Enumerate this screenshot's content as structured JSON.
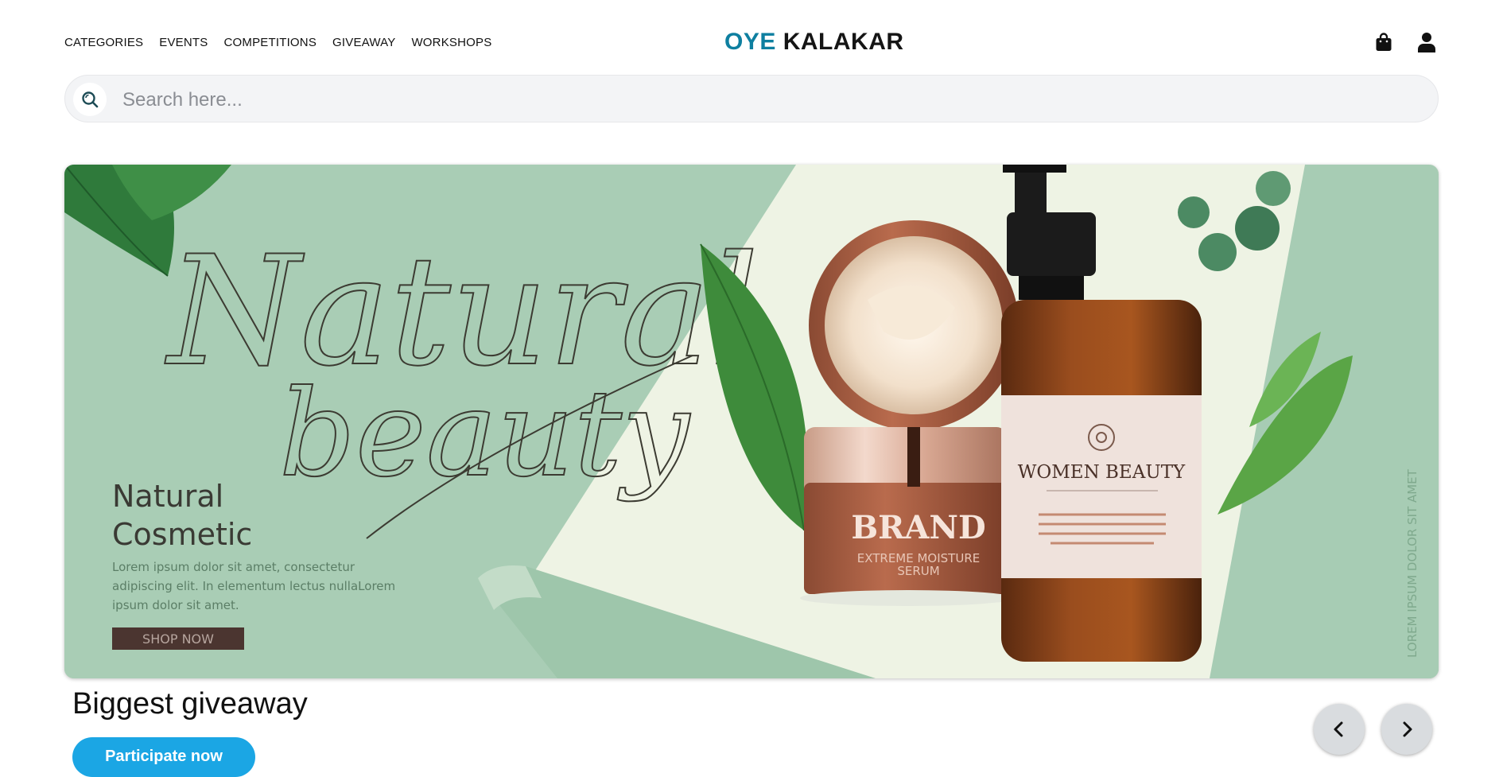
{
  "header": {
    "nav": [
      "CATEGORIES",
      "EVENTS",
      "COMPETITIONS",
      "GIVEAWAY",
      "WORKSHOPS"
    ],
    "logo_part1": "OYE",
    "logo_part2": "KALAKAR",
    "icons": [
      "shopping-bag-icon",
      "user-icon"
    ]
  },
  "search": {
    "placeholder": "Search here..."
  },
  "banner": {
    "script_line1": "Natural",
    "script_line2": "beauty",
    "heading_line1": "Natural",
    "heading_line2": "Cosmetic",
    "body_line1": "Lorem ipsum dolor sit amet, consectetur",
    "body_line2": "adipiscing elit. In elementum lectus nullaLorem",
    "body_line3": "ipsum dolor sit amet.",
    "shop_now": "SHOP NOW",
    "jar_brand": "BRAND",
    "jar_sub1": "EXTREME MOISTURE",
    "jar_sub2": "SERUM",
    "bottle_label": "WOMEN BEAUTY",
    "side_text": "LOREM IPSUM DOLOR SIT AMET"
  },
  "giveaway": {
    "title": "Biggest giveaway",
    "button": "Participate now"
  },
  "carousel": {
    "prev_icon": "chevron-left-icon",
    "next_icon": "chevron-right-icon"
  },
  "colors": {
    "logo_accent": "#0e7fa0",
    "button_blue": "#1ba6e4",
    "banner_green": "#a9cdb5"
  }
}
